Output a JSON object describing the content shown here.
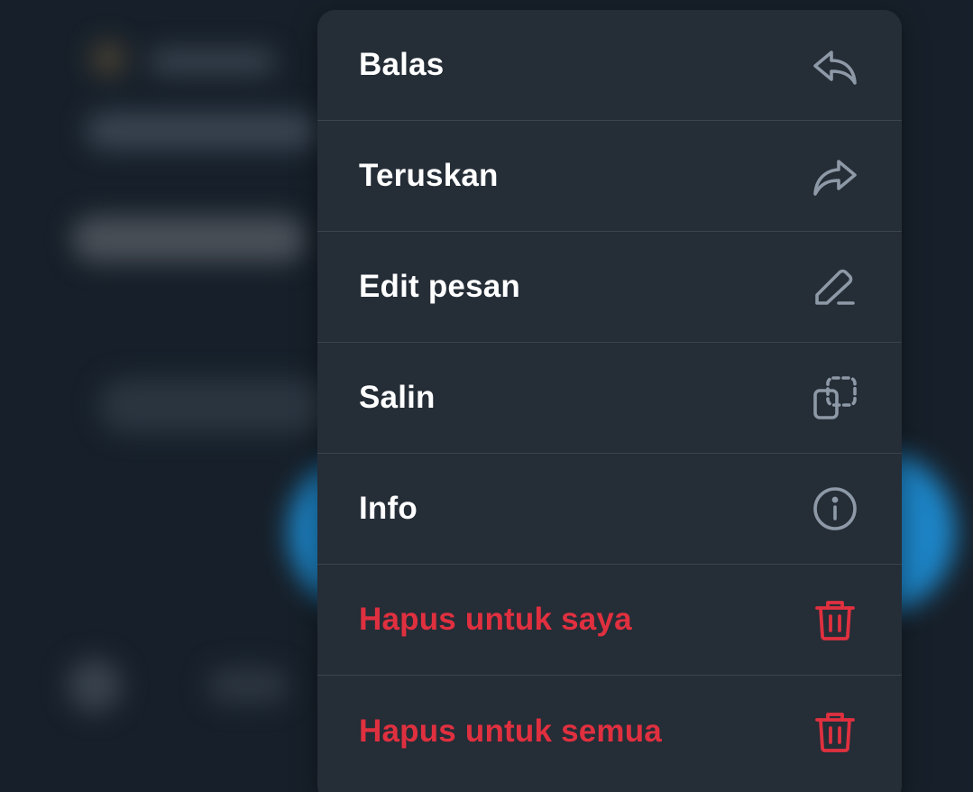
{
  "colors": {
    "menu_bg": "#252d37",
    "divider": "#3a434e",
    "text": "#ffffff",
    "icon": "#8d99a6",
    "danger": "#e0303f"
  },
  "context_menu": {
    "items": [
      {
        "label": "Balas",
        "icon": "reply-icon"
      },
      {
        "label": "Teruskan",
        "icon": "forward-icon"
      },
      {
        "label": "Edit pesan",
        "icon": "pencil-icon"
      },
      {
        "label": "Salin",
        "icon": "copy-icon"
      },
      {
        "label": "Info",
        "icon": "info-icon"
      },
      {
        "label": "Hapus untuk saya",
        "icon": "trash-icon"
      },
      {
        "label": "Hapus untuk semua",
        "icon": "trash-icon"
      }
    ]
  }
}
